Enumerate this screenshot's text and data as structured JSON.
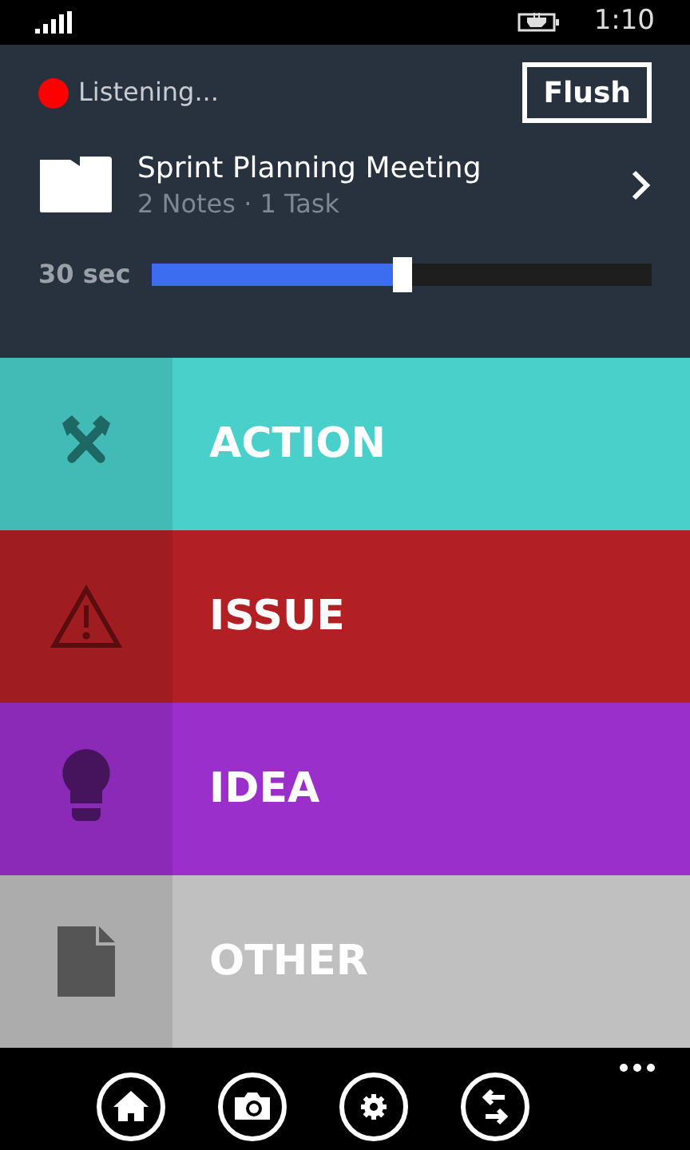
{
  "status_bar": {
    "time": "1:10"
  },
  "recorder": {
    "recording": true,
    "status": "Listening...",
    "flush_button": "Flush"
  },
  "meeting": {
    "title": "Sprint Planning Meeting",
    "subtitle": "2 Notes · 1 Task"
  },
  "duration": {
    "label": "30 sec",
    "level": 0.5
  },
  "categories": [
    {
      "kind": "action",
      "label": "ACTION",
      "color": "#4ad0cb"
    },
    {
      "kind": "issue",
      "label": "ISSUE",
      "color": "#b22024"
    },
    {
      "kind": "idea",
      "label": "IDEA",
      "color": "#9a2fcc"
    },
    {
      "kind": "other",
      "label": "OTHER",
      "color": "#c0c0c0"
    }
  ],
  "app_bar": {
    "buttons": [
      {
        "kind": "home"
      },
      {
        "kind": "camera"
      },
      {
        "kind": "settings"
      },
      {
        "kind": "swap"
      }
    ]
  }
}
